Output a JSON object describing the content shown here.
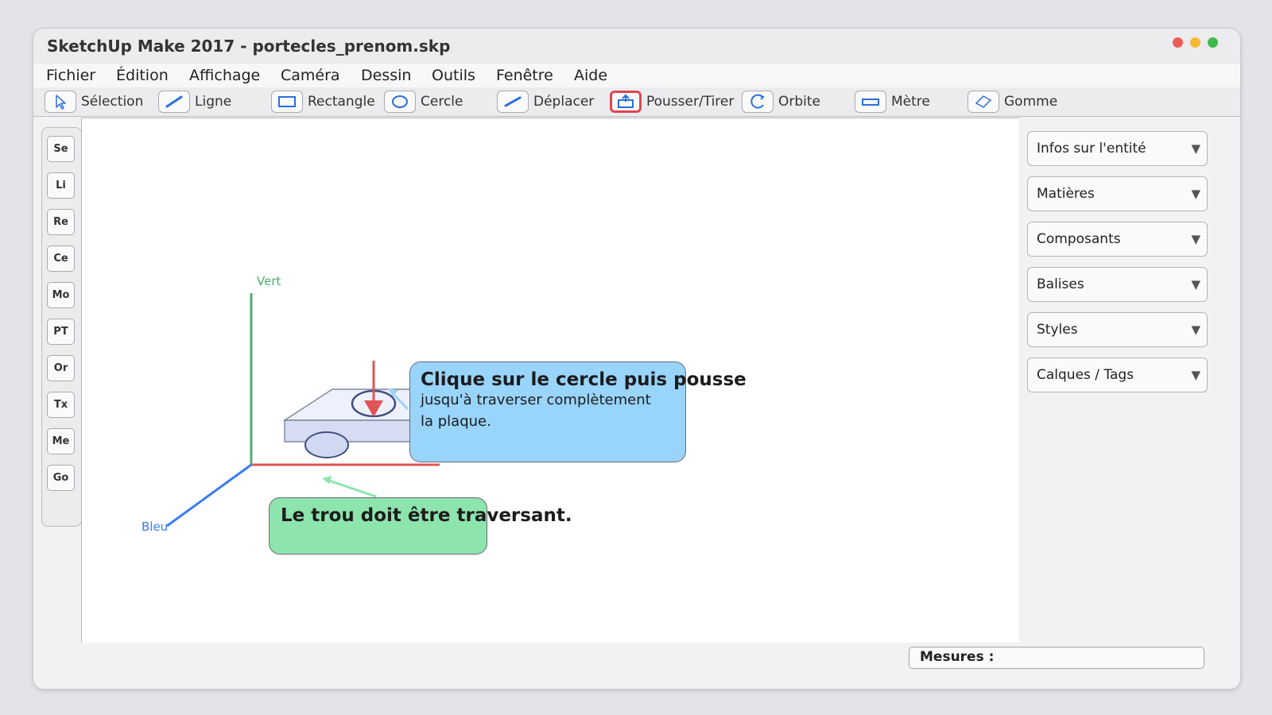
{
  "window": {
    "title": "SketchUp Make 2017 - portecles_prenom.skp"
  },
  "traffic_lights": {
    "close": "#ee5b55",
    "minimize": "#f6b935",
    "maximize": "#3dba4b"
  },
  "menu": [
    "Fichier",
    "Édition",
    "Affichage",
    "Caméra",
    "Dessin",
    "Outils",
    "Fenêtre",
    "Aide"
  ],
  "toolbar": [
    {
      "label": "Sélection",
      "icon": "arrow-cursor-icon"
    },
    {
      "label": "Ligne",
      "icon": "pencil-line-icon"
    },
    {
      "label": "Rectangle",
      "icon": "rectangle-icon"
    },
    {
      "label": "Cercle",
      "icon": "circle-icon"
    },
    {
      "label": "Déplacer",
      "icon": "move-icon"
    },
    {
      "label": "Pousser/Tirer",
      "icon": "push-pull-icon",
      "active": true
    },
    {
      "label": "Orbite",
      "icon": "orbit-icon"
    },
    {
      "label": "Mètre",
      "icon": "tape-measure-icon"
    },
    {
      "label": "Gomme",
      "icon": "eraser-icon"
    }
  ],
  "side_toolbar": [
    "Se",
    "Li",
    "Re",
    "Ce",
    "Mo",
    "PT",
    "Or",
    "Tx",
    "Me",
    "Go"
  ],
  "viewport": {
    "axis_labels": {
      "green": "Vert",
      "blue": "Bleu"
    },
    "axis_colors": {
      "green": "#4caf73",
      "red": "#e05555",
      "blue": "#3b7ded"
    },
    "callout_main": {
      "title": "Clique sur le cercle puis pousse",
      "body_line1": "jusqu'à traverser complètement",
      "body_line2": "la plaque."
    },
    "callout_note": {
      "text": "Le trou doit être traversant."
    }
  },
  "tray_panels": [
    "Infos sur l'entité",
    "Matières",
    "Composants",
    "Balises",
    "Styles",
    "Calques / Tags"
  ],
  "statusbar": {
    "measures_label": "Mesures :",
    "measures_value": ""
  }
}
